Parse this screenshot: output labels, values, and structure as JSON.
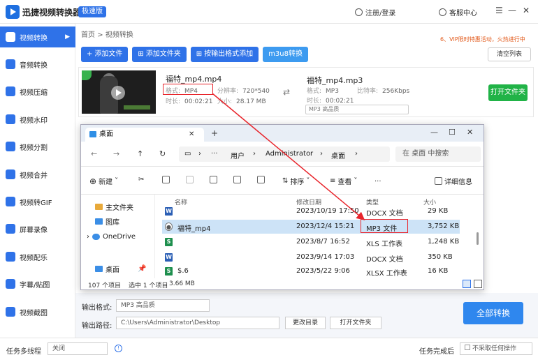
{
  "app": {
    "name": "迅捷视频转换器",
    "edition_badge": "极速版",
    "login_label": "注册/登录",
    "service_label": "客服中心"
  },
  "sidebar": {
    "items": [
      {
        "label": "视频转换",
        "icon": "video-convert-icon",
        "active": true
      },
      {
        "label": "音频转换",
        "icon": "audio-convert-icon"
      },
      {
        "label": "视频压缩",
        "icon": "compress-icon"
      },
      {
        "label": "视频水印",
        "icon": "watermark-icon"
      },
      {
        "label": "视频分割",
        "icon": "split-icon"
      },
      {
        "label": "视频合并",
        "icon": "merge-icon"
      },
      {
        "label": "视频转GIF",
        "icon": "gif-icon"
      },
      {
        "label": "屏幕录像",
        "icon": "screen-record-icon"
      },
      {
        "label": "视频配乐",
        "icon": "music-icon"
      },
      {
        "label": "字幕/贴图",
        "icon": "subtitle-icon"
      },
      {
        "label": "视频截图",
        "icon": "screenshot-icon"
      }
    ]
  },
  "breadcrumb": {
    "home": "首页",
    "sep": ">",
    "current": "视频转换"
  },
  "promo_text": "6、VIP限时特惠活动，火热进行中",
  "toolbar": {
    "add_file": "添加文件",
    "add_folder": "添加文件夹",
    "add_by_format": "按输出格式添加",
    "m3u8": "m3u8转换",
    "clear_list": "清空列表"
  },
  "file": {
    "src_name": "福特_mp4.mp4",
    "src_format_label": "格式:",
    "src_format": "MP4",
    "src_res_label": "分辨率:",
    "src_res": "720*540",
    "src_dur_label": "时长:",
    "src_dur": "00:02:21",
    "src_size_label": "大小:",
    "src_size": "28.17 MB",
    "dst_name": "福特_mp4.mp3",
    "dst_format_label": "格式:",
    "dst_format": "MP3",
    "dst_bitrate_label": "比特率:",
    "dst_bitrate": "256Kbps",
    "dst_dur_label": "时长:",
    "dst_dur": "00:02:21",
    "dst_quality": "MP3 高品质",
    "open_folder": "打开文件夹"
  },
  "explorer": {
    "tab_title": "桌面",
    "path": [
      "用户",
      "Administrator",
      "桌面"
    ],
    "search_placeholder": "在 桌面 中搜索",
    "cmd": {
      "new": "新建",
      "sort": "排序",
      "view": "查看",
      "more": "...",
      "details": "详细信息"
    },
    "nav": [
      {
        "label": "主文件夹"
      },
      {
        "label": "图库"
      },
      {
        "label": "OneDrive"
      },
      {
        "label": "桌面"
      }
    ],
    "columns": {
      "name": "名称",
      "modified": "修改日期",
      "type": "类型",
      "size": "大小"
    },
    "files": [
      {
        "name": "",
        "modified": "2023/10/19 17:50",
        "type": "DOCX 文档",
        "size": "29 KB",
        "kind": "W",
        "color": "#2b5fb5"
      },
      {
        "name": "福特_mp4",
        "modified": "2023/12/4 15:21",
        "type": "MP3 文件",
        "size": "3,752 KB",
        "kind": "●",
        "color": "#555555",
        "selected": true
      },
      {
        "name": "",
        "modified": "2023/8/7 16:52",
        "type": "XLS 工作表",
        "size": "1,248 KB",
        "kind": "S",
        "color": "#1e8f4e"
      },
      {
        "name": "",
        "modified": "2023/9/14 17:03",
        "type": "DOCX 文档",
        "size": "350 KB",
        "kind": "W",
        "color": "#2b5fb5"
      },
      {
        "name": "$.6",
        "modified": "2023/5/22 9:06",
        "type": "XLSX 工作表",
        "size": "16 KB",
        "kind": "S",
        "color": "#1e8f4e"
      }
    ],
    "status": {
      "count": "107 个项目",
      "selected": "选中 1 个项目",
      "size": "3.66 MB"
    }
  },
  "bottom": {
    "output_format_label": "输出格式:",
    "output_format": "MP3 高品质",
    "output_path_label": "输出路径:",
    "output_path": "C:\\Users\\Administrator\\Desktop",
    "change_dir": "更改目录",
    "open_folder": "打开文件夹",
    "convert_all": "全部转换",
    "multithread_label": "任务多线程",
    "multithread_value": "关闭",
    "after_label": "任务完成后",
    "after_value": "不采取任何操作"
  }
}
